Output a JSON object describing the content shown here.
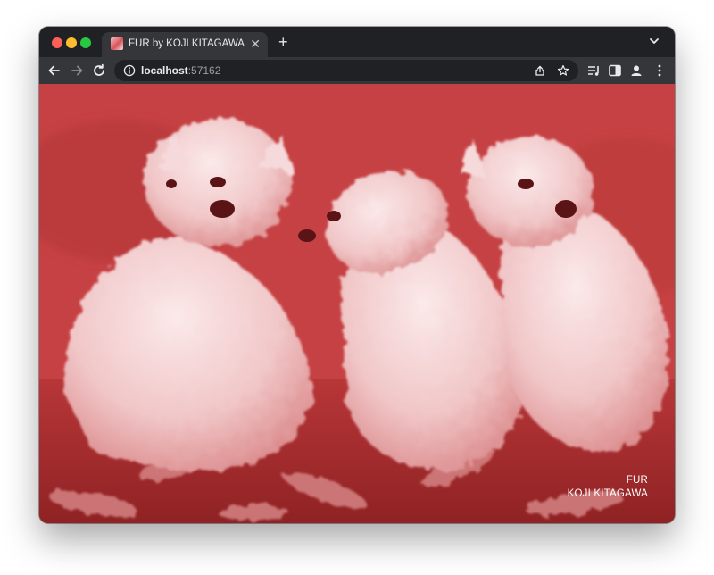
{
  "browser": {
    "tab": {
      "title": "FUR by KOJI KITAGAWA",
      "favicon_icon": "photo-favicon-icon"
    },
    "address_bar": {
      "host": "localhost",
      "port": ":57162"
    },
    "icons": [
      "back-arrow-icon",
      "forward-arrow-icon",
      "reload-icon",
      "info-icon",
      "share-icon",
      "bookmark-star-icon",
      "reading-list-icon",
      "side-panel-icon",
      "profile-icon",
      "more-menu-icon",
      "tab-search-chevron-icon"
    ]
  },
  "page": {
    "background_color": "#c74446",
    "image_description_icon": "puppies-photo",
    "caption": {
      "line1": "FUR",
      "line2": "KOJI KITAGAWA"
    }
  }
}
